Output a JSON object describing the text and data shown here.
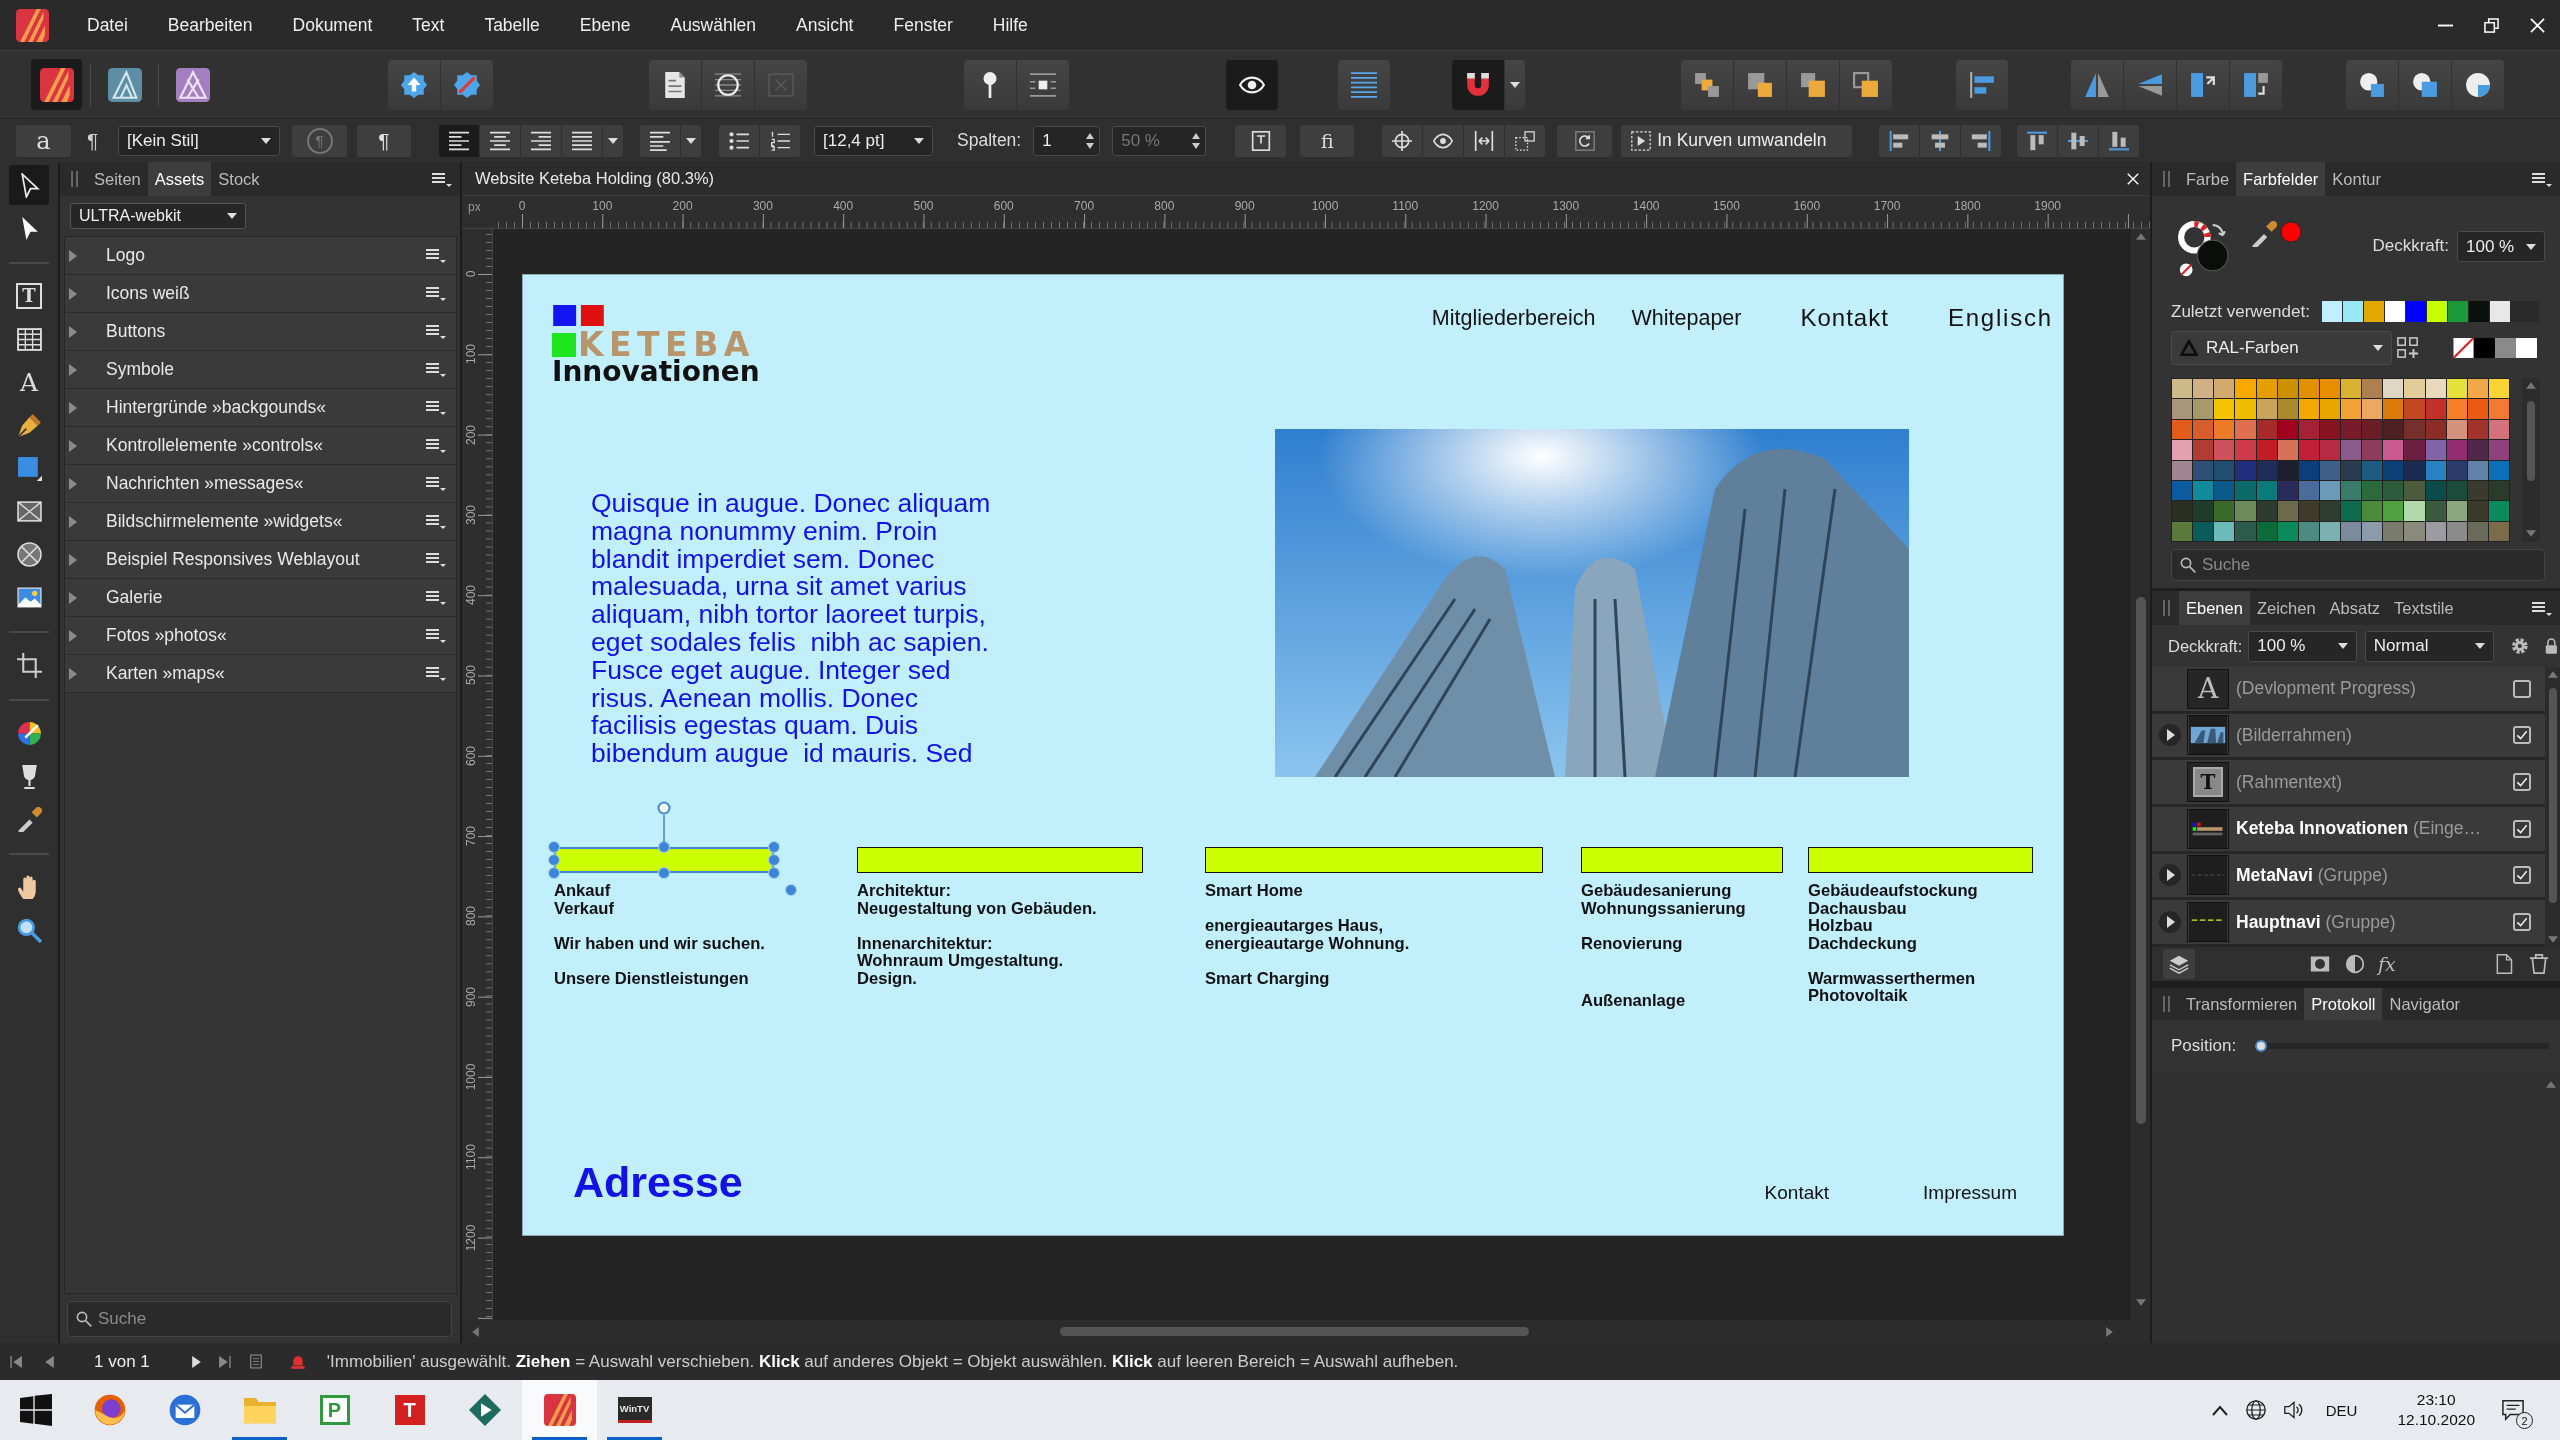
{
  "menu_bar": {
    "items": [
      "Datei",
      "Bearbeiten",
      "Dokument",
      "Text",
      "Tabelle",
      "Ebene",
      "Auswählen",
      "Ansicht",
      "Fenster",
      "Hilfe"
    ]
  },
  "personas": [
    {
      "kind": "publisher",
      "selected": true
    },
    {
      "kind": "designer",
      "selected": false
    },
    {
      "kind": "photo",
      "selected": false
    }
  ],
  "toolbar": [
    {
      "buttons": [
        {
          "kind": "upload-badge",
          "on": false,
          "disabled": false
        },
        {
          "kind": "slashed-badge",
          "on": false,
          "disabled": false
        }
      ]
    },
    {
      "buttons": [
        {
          "kind": "page",
          "on": false,
          "disabled": false
        },
        {
          "kind": "circle-lines",
          "on": false,
          "disabled": false
        },
        {
          "kind": "crossed-box",
          "on": false,
          "disabled": true
        }
      ]
    },
    {
      "buttons": [
        {
          "kind": "pin",
          "on": false,
          "disabled": false
        },
        {
          "kind": "pin-lines",
          "on": false,
          "disabled": false
        }
      ]
    },
    {
      "buttons": [
        {
          "kind": "preview",
          "on": true,
          "disabled": false
        }
      ]
    },
    {
      "buttons": [
        {
          "kind": "baseline-grid",
          "on": false,
          "disabled": false
        }
      ]
    },
    {
      "buttons": [
        {
          "kind": "magnet",
          "on": true,
          "disabled": false
        },
        {
          "kind": "caret",
          "on": false,
          "disabled": false
        }
      ]
    },
    {
      "buttons": [
        {
          "kind": "arrange-1",
          "on": false,
          "disabled": false
        },
        {
          "kind": "arrange-2",
          "on": false,
          "disabled": false
        },
        {
          "kind": "arrange-3",
          "on": false,
          "disabled": false
        },
        {
          "kind": "arrange-4",
          "on": false,
          "disabled": false
        }
      ]
    },
    {
      "buttons": [
        {
          "kind": "align-panel",
          "on": false,
          "disabled": false
        }
      ]
    },
    {
      "buttons": [
        {
          "kind": "flip-h",
          "on": false,
          "disabled": false
        },
        {
          "kind": "flip-v",
          "on": false,
          "disabled": false
        },
        {
          "kind": "rotate-l",
          "on": false,
          "disabled": false
        },
        {
          "kind": "rotate-r",
          "on": false,
          "disabled": false
        }
      ]
    },
    {
      "buttons": [
        {
          "kind": "bool-add",
          "on": false,
          "disabled": false
        },
        {
          "kind": "bool-sub",
          "on": false,
          "disabled": false
        },
        {
          "kind": "bool-int",
          "on": false,
          "disabled": false
        }
      ]
    }
  ],
  "context_toolbar": [
    {
      "kind": "glyph-button",
      "label": "a",
      "disabled": false
    },
    {
      "kind": "glyph",
      "label": "¶"
    },
    {
      "kind": "dropdown",
      "value": "[Kein Stil]"
    },
    {
      "kind": "ring-glyph-button",
      "label": "¶",
      "disabled": true
    },
    {
      "kind": "glyph-button",
      "label": "¶",
      "disabled": false
    },
    {
      "kind": "icon-group",
      "buttons": [
        {
          "kind": "align-left",
          "selected": true
        },
        {
          "kind": "align-center",
          "selected": false
        },
        {
          "kind": "align-right",
          "selected": false
        },
        {
          "kind": "justify",
          "selected": false
        }
      ],
      "caret": true
    },
    {
      "kind": "icon-group",
      "buttons": [
        {
          "kind": "paragraph-lines"
        }
      ],
      "caret": true
    },
    {
      "kind": "icon-group",
      "buttons": [
        {
          "kind": "bullet-list"
        },
        {
          "kind": "numbered-list"
        }
      ]
    },
    {
      "kind": "dropdown",
      "value": "[12,4 pt]"
    },
    {
      "kind": "label",
      "text": "Spalten:"
    },
    {
      "kind": "spinner",
      "value": "1",
      "disabled": false
    },
    {
      "kind": "spinner",
      "value": "50 %",
      "disabled": true
    },
    {
      "kind": "icon-group",
      "buttons": [
        {
          "kind": "text-frame"
        }
      ]
    },
    {
      "kind": "glyph-button",
      "label": "fi",
      "disabled": false
    },
    {
      "kind": "icon-group",
      "buttons": [
        {
          "kind": "crosshair"
        },
        {
          "kind": "eye"
        },
        {
          "kind": "distribute"
        },
        {
          "kind": "transform"
        }
      ]
    },
    {
      "kind": "icon-group",
      "buttons": [
        {
          "kind": "rotate-frame"
        }
      ]
    },
    {
      "kind": "text-button",
      "label": "In Kurven umwandeln"
    },
    {
      "kind": "icon-group",
      "buttons": [
        {
          "kind": "align-left-edge"
        },
        {
          "kind": "align-h-center"
        },
        {
          "kind": "align-right-edge"
        }
      ]
    },
    {
      "kind": "icon-group",
      "buttons": [
        {
          "kind": "align-top-edge"
        },
        {
          "kind": "align-v-center"
        },
        {
          "kind": "align-bottom-edge"
        }
      ]
    }
  ],
  "tools": [
    [
      {
        "kind": "pointer",
        "selected": true
      },
      {
        "kind": "node-pointer",
        "selected": false
      }
    ],
    [
      {
        "kind": "frame-text",
        "glyph": "T",
        "selected": false
      },
      {
        "kind": "table",
        "selected": false
      },
      {
        "kind": "artistic-text",
        "glyph": "A",
        "selected": false
      },
      {
        "kind": "pen",
        "selected": false
      },
      {
        "kind": "rectangle",
        "selected": false
      },
      {
        "kind": "rect-frame",
        "selected": false
      },
      {
        "kind": "ellipse-frame",
        "selected": false
      },
      {
        "kind": "picture",
        "selected": false
      }
    ],
    [
      {
        "kind": "crop",
        "selected": false
      }
    ],
    [
      {
        "kind": "color-wheel",
        "selected": false
      },
      {
        "kind": "fill",
        "selected": false
      },
      {
        "kind": "pipette",
        "selected": false
      }
    ],
    [
      {
        "kind": "hand",
        "selected": false
      },
      {
        "kind": "zoom",
        "selected": false
      }
    ]
  ],
  "left_panel": {
    "tabs": [
      {
        "label": "Seiten",
        "selected": false
      },
      {
        "label": "Assets",
        "selected": true
      },
      {
        "label": "Stock",
        "selected": false
      }
    ],
    "library": "ULTRA-webkit",
    "categories": [
      {
        "label": "Logo",
        "expanded": false
      },
      {
        "label": "Icons weiß",
        "expanded": false
      },
      {
        "label": "Buttons",
        "expanded": false
      },
      {
        "label": "Symbole",
        "expanded": false
      },
      {
        "label": "Hintergründe »backgounds«",
        "expanded": false
      },
      {
        "label": "Kontrollelemente »controls«",
        "expanded": false
      },
      {
        "label": "Nachrichten »messages«",
        "expanded": false
      },
      {
        "label": "Bildschirmelemente »widgets«",
        "expanded": false
      },
      {
        "label": "Beispiel Responsives Weblayout",
        "expanded": false
      },
      {
        "label": "Galerie",
        "expanded": false
      },
      {
        "label": "Fotos »photos«",
        "expanded": false
      },
      {
        "label": "Karten »maps«",
        "expanded": false
      }
    ],
    "search": {
      "placeholder": "Suche"
    }
  },
  "document": {
    "tab": "Website Keteba Holding (80.3%)",
    "rulers": {
      "unit": "px",
      "horizontal": [
        "0",
        "100",
        "200",
        "300",
        "400",
        "500",
        "600",
        "700",
        "800",
        "900",
        "1000",
        "1100",
        "1200",
        "1300",
        "1400",
        "1500",
        "1600",
        "1700",
        "1800",
        "1900"
      ],
      "vertical": [
        "0",
        "100",
        "200",
        "300",
        "400",
        "500",
        "600",
        "700",
        "800",
        "900",
        "1000",
        "1100",
        "1200"
      ]
    },
    "page": {
      "logo": {
        "wordmark": "KETEBA",
        "tagline": "Innovationen"
      },
      "nav": [
        "Mitgliederbereich",
        "Whitepaper",
        "Kontakt",
        "Englisch"
      ],
      "intro": [
        "Quisque in augue. Donec aliquam",
        "magna nonummy enim. Proin",
        "blandit imperdiet sem. Donec",
        "malesuada, urna sit amet varius",
        "aliquam, nibh tortor laoreet turpis,",
        "eget sodales felis  nibh ac sapien.",
        "Fusce eget augue. Integer sed",
        "risus. Aenean mollis. Donec",
        "facilisis egestas quam. Duis",
        "bibendum augue  id mauris. Sed"
      ],
      "features": [
        {
          "selected": true,
          "paragraphs": [
            [
              "Ankauf",
              "Verkauf"
            ],
            [
              "Wir haben und wir suchen."
            ],
            [
              "Unsere Dienstleistungen"
            ]
          ]
        },
        {
          "selected": false,
          "paragraphs": [
            [
              "Architektur:",
              "Neugestaltung von Gebäuden."
            ],
            [
              "Innenarchitektur:",
              "Wohnraum Umgestaltung.",
              "Design."
            ]
          ]
        },
        {
          "selected": false,
          "paragraphs": [
            [
              "Smart Home"
            ],
            [
              "energieautarges Haus,",
              "energieautarge Wohnung."
            ],
            [
              "Smart Charging"
            ]
          ]
        },
        {
          "selected": false,
          "paragraphs": [
            [
              "Gebäudesanierung",
              "Wohnungssanierung"
            ],
            [
              "Renovierung"
            ],
            [
              "Außenanlage"
            ]
          ]
        },
        {
          "selected": false,
          "paragraphs": [
            [
              "Gebäudeaufstockung",
              "Dachausbau",
              "Holzbau",
              "Dachdeckung"
            ],
            [
              "Warmwasserthermen",
              "Photovoltaik"
            ]
          ]
        }
      ],
      "footer": {
        "heading": "Adresse",
        "links": [
          "Kontakt",
          "Impressum"
        ]
      }
    }
  },
  "color_panel": {
    "tabs": [
      {
        "label": "Farbe",
        "selected": false
      },
      {
        "label": "Farbfelder",
        "selected": true
      },
      {
        "label": "Kontur",
        "selected": false
      }
    ],
    "opacity_label": "Deckkraft:",
    "opacity": "100 %",
    "recent_label": "Zuletzt verwendet:",
    "recent": [
      {
        "color": "#c2effd"
      },
      {
        "color": "#9ae7f8"
      },
      {
        "color": "#e2a800"
      },
      {
        "color": "#ffffff"
      },
      {
        "color": "#0000ff"
      },
      {
        "color": "#c8ff00"
      },
      {
        "color": "#1a9a3a"
      },
      {
        "color": "#0a100c"
      },
      {
        "color": "#e8e8e8"
      }
    ],
    "palette": "RAL-Farben",
    "quick": [
      {
        "kind": "none"
      },
      {
        "kind": "color",
        "color": "#000000"
      },
      {
        "kind": "color",
        "color": "#8a8a8a"
      },
      {
        "kind": "color",
        "color": "#ffffff"
      }
    ],
    "swatches": [
      {
        "color": "#cdba88"
      },
      {
        "color": "#d0b084"
      },
      {
        "color": "#d2aa6d"
      },
      {
        "color": "#f9a800"
      },
      {
        "color": "#e49e00"
      },
      {
        "color": "#cb8f00"
      },
      {
        "color": "#e29000"
      },
      {
        "color": "#e88c00"
      },
      {
        "color": "#d9b231"
      },
      {
        "color": "#af804f"
      },
      {
        "color": "#ddd7c3"
      },
      {
        "color": "#e3cc9c"
      },
      {
        "color": "#e8d9bc"
      },
      {
        "color": "#e5e13a"
      },
      {
        "color": "#f1a848"
      },
      {
        "color": "#f6d534"
      },
      {
        "color": "#a8957a"
      },
      {
        "color": "#a69a6a"
      },
      {
        "color": "#f3c200"
      },
      {
        "color": "#efbe00"
      },
      {
        "color": "#c9a35a"
      },
      {
        "color": "#a88a2c"
      },
      {
        "color": "#f4a900"
      },
      {
        "color": "#e7a500"
      },
      {
        "color": "#f3a234"
      },
      {
        "color": "#eda765"
      },
      {
        "color": "#dd7b0a"
      },
      {
        "color": "#c2461f"
      },
      {
        "color": "#c1312a"
      },
      {
        "color": "#f47e2a"
      },
      {
        "color": "#e95a13"
      },
      {
        "color": "#f27a32"
      },
      {
        "color": "#e45c1c"
      },
      {
        "color": "#d75d2c"
      },
      {
        "color": "#ec7a28"
      },
      {
        "color": "#df6f4f"
      },
      {
        "color": "#a72a2a"
      },
      {
        "color": "#a2001f"
      },
      {
        "color": "#a52236"
      },
      {
        "color": "#87131f"
      },
      {
        "color": "#7a1b2b"
      },
      {
        "color": "#6a1d26"
      },
      {
        "color": "#4d2024"
      },
      {
        "color": "#76302b"
      },
      {
        "color": "#8a2d26"
      },
      {
        "color": "#d4927c"
      },
      {
        "color": "#a1322c"
      },
      {
        "color": "#d3727b"
      },
      {
        "color": "#e4a0b1"
      },
      {
        "color": "#b23b33"
      },
      {
        "color": "#cc515b"
      },
      {
        "color": "#cf3a48"
      },
      {
        "color": "#c11d25"
      },
      {
        "color": "#d6715a"
      },
      {
        "color": "#c21f3a"
      },
      {
        "color": "#b62a42"
      },
      {
        "color": "#895b88"
      },
      {
        "color": "#8e3c5c"
      },
      {
        "color": "#c9598f"
      },
      {
        "color": "#6c1f41"
      },
      {
        "color": "#8163a8"
      },
      {
        "color": "#912c70"
      },
      {
        "color": "#4f2849"
      },
      {
        "color": "#8f417b"
      },
      {
        "color": "#a08591"
      },
      {
        "color": "#2e4f78"
      },
      {
        "color": "#1f4e6f"
      },
      {
        "color": "#1f2f7b"
      },
      {
        "color": "#1f2e58"
      },
      {
        "color": "#1b1f2e"
      },
      {
        "color": "#0b3f7b"
      },
      {
        "color": "#3f5f8a"
      },
      {
        "color": "#2b3a4e"
      },
      {
        "color": "#1f5b80"
      },
      {
        "color": "#0b4079"
      },
      {
        "color": "#1b2b4f"
      },
      {
        "color": "#2a81c0"
      },
      {
        "color": "#2b3b6b"
      },
      {
        "color": "#6181a8"
      },
      {
        "color": "#0a71b8"
      },
      {
        "color": "#0b5ba0"
      },
      {
        "color": "#118a9a"
      },
      {
        "color": "#0b5b8a"
      },
      {
        "color": "#0b6b6b"
      },
      {
        "color": "#0b7a7a"
      },
      {
        "color": "#2b2b5b"
      },
      {
        "color": "#4b6b9b"
      },
      {
        "color": "#6a9ab8"
      },
      {
        "color": "#3b7b6b"
      },
      {
        "color": "#2b6b3b"
      },
      {
        "color": "#2b5b3b"
      },
      {
        "color": "#4b5b3b"
      },
      {
        "color": "#0b4b4b"
      },
      {
        "color": "#1b4b3b"
      },
      {
        "color": "#3a3a2f"
      },
      {
        "color": "#2b3b2b"
      },
      {
        "color": "#2b2f23"
      },
      {
        "color": "#1f3b2b"
      },
      {
        "color": "#3b6b2b"
      },
      {
        "color": "#6b8b5b"
      },
      {
        "color": "#2b3b2f"
      },
      {
        "color": "#6b6b4b"
      },
      {
        "color": "#3f3b2b"
      },
      {
        "color": "#2f3b2f"
      },
      {
        "color": "#0b6b4b"
      },
      {
        "color": "#4b8b3b"
      },
      {
        "color": "#51a141"
      },
      {
        "color": "#b1d9a9"
      },
      {
        "color": "#3b5b3f"
      },
      {
        "color": "#8ba981"
      },
      {
        "color": "#3b3b2b"
      },
      {
        "color": "#0b8b5b"
      },
      {
        "color": "#5b7b3b"
      },
      {
        "color": "#0b5b5b"
      },
      {
        "color": "#6bbbb9"
      },
      {
        "color": "#2b5b4b"
      },
      {
        "color": "#0b6b3b"
      },
      {
        "color": "#0b8b5c"
      },
      {
        "color": "#4b8b81"
      },
      {
        "color": "#7bb1b1"
      },
      {
        "color": "#7b8b9b"
      },
      {
        "color": "#8b9ba9"
      },
      {
        "color": "#7b7b6b"
      },
      {
        "color": "#8b8b7b"
      },
      {
        "color": "#9b9ba1"
      },
      {
        "color": "#8b8b8b"
      },
      {
        "color": "#6b6b5b"
      },
      {
        "color": "#7b6b4b"
      }
    ],
    "search": {
      "placeholder": "Suche"
    }
  },
  "layers_panel": {
    "tabs": [
      {
        "label": "Ebenen",
        "selected": true
      },
      {
        "label": "Zeichen",
        "selected": false
      },
      {
        "label": "Absatz",
        "selected": false
      },
      {
        "label": "Textstile",
        "selected": false
      }
    ],
    "opacity_label": "Deckkraft:",
    "opacity": "100 %",
    "blend_mode": "Normal",
    "layers": [
      {
        "kind": "artistic-text",
        "glyph": "A",
        "name": "(Devlopment Progress)",
        "visible": false
      },
      {
        "kind": "picture-frame",
        "name": "(Bilderrahmen)",
        "visible": true,
        "expanded": false
      },
      {
        "kind": "frame-text",
        "glyph": "T",
        "name": "(Rahmentext)",
        "visible": true
      },
      {
        "kind": "image",
        "name": "**Keteba Innovationen** (Einge…",
        "visible": true
      },
      {
        "kind": "group",
        "name": "**MetaNavi** (Gruppe)",
        "visible": true,
        "expanded": false
      },
      {
        "kind": "group-lines",
        "name": "**Hauptnavi** (Gruppe)",
        "visible": true,
        "expanded": false
      }
    ],
    "fx": "fx"
  },
  "transform_panel": {
    "tabs": [
      {
        "label": "Transformieren",
        "selected": false
      },
      {
        "label": "Protokoll",
        "selected": true
      },
      {
        "label": "Navigator",
        "selected": false
      }
    ],
    "position_label": "Position:",
    "position": {
      "level": 0
    }
  },
  "status_bar": {
    "page": "1 von 1",
    "message": "'Immobilien' ausgewählt. **Ziehen** = Auswahl verschieben. **Klick** auf anderes Objekt = Objekt auswählen. **Klick** auf leeren Bereich = Auswahl aufheben."
  },
  "taskbar": {
    "apps": [
      {
        "kind": "browser",
        "running": false,
        "selected": false
      },
      {
        "kind": "mail",
        "running": false,
        "selected": false
      },
      {
        "kind": "folder",
        "running": true,
        "selected": false
      },
      {
        "kind": "outline-letter",
        "label": "P",
        "color": "#2e9a3e",
        "running": false,
        "selected": false
      },
      {
        "kind": "filled-letter",
        "label": "T",
        "color": "#d42020",
        "running": false,
        "selected": false
      },
      {
        "kind": "diamond",
        "running": false,
        "selected": false
      },
      {
        "kind": "publisher",
        "running": true,
        "selected": true
      },
      {
        "kind": "tv-tile",
        "label": "WinTV",
        "running": true,
        "selected": false
      }
    ],
    "language": "DEU",
    "time": "23:10",
    "date": "12.10.2020",
    "notifications": "2"
  }
}
